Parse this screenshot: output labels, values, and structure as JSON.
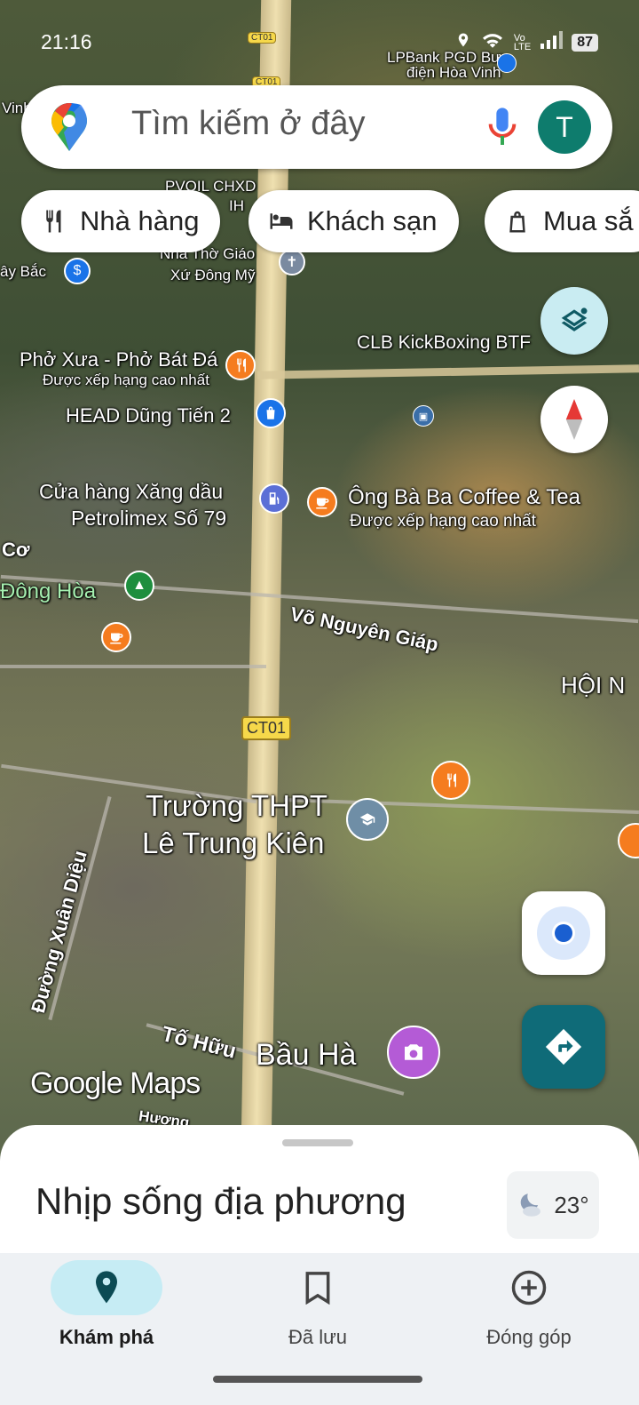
{
  "status_bar": {
    "time": "21:16",
    "battery": "87"
  },
  "search": {
    "placeholder": "Tìm kiếm ở đây",
    "avatar_letter": "T"
  },
  "chips": [
    {
      "label": "Nhà hàng",
      "icon": "restaurant-icon"
    },
    {
      "label": "Khách sạn",
      "icon": "hotel-icon"
    },
    {
      "label": "Mua sắ",
      "icon": "shopping-bag-icon"
    }
  ],
  "map": {
    "road_shields": [
      "CT01",
      "CT01",
      "CT01"
    ],
    "labels": {
      "lpbank": "LPBank PGD Bưu",
      "lpbank2": "điện Hòa Vinh",
      "vinh": "Vinh",
      "pvoil": "PVOIL CHXD",
      "pvoil2": "IH",
      "nhatho": "Nhà Thờ Giáo",
      "nhatho2": "Xứ Đông Mỹ",
      "taybac": "ây Bắc",
      "kickboxing": "CLB KickBoxing BTF",
      "phoxua": "Phở Xưa - Phở Bát Đá",
      "phoxua_sub": "Được xếp hạng cao nhất",
      "head": "HEAD Dũng Tiến 2",
      "xang": "Cửa hàng Xăng dầu",
      "xang2": "Petrolimex Số 79",
      "ongbaba": "Ông Bà Ba Coffee & Tea",
      "ongbaba_sub": "Được xếp hạng cao nhất",
      "co": "Cơ",
      "donghoa": "Đông Hòa",
      "vonguyengiap": "Võ Nguyên Giáp",
      "hoin": "HỘI N",
      "truong": "Trường THPT",
      "truong2": "Lê Trung Kiên",
      "xuandieu": "Đường Xuân Diệu",
      "tohuu": "Tố Hữu",
      "bauha": "Bầu Hà",
      "google": "Google Maps",
      "huong": "Hương"
    }
  },
  "bottom_sheet": {
    "title": "Nhịp sống địa phương",
    "temperature": "23°"
  },
  "nav": [
    {
      "label": "Khám phá",
      "icon": "explore-pin-icon",
      "active": true
    },
    {
      "label": "Đã lưu",
      "icon": "bookmark-icon",
      "active": false
    },
    {
      "label": "Đóng góp",
      "icon": "add-circle-icon",
      "active": false
    }
  ],
  "colors": {
    "accent": "#0f6b78",
    "avatar": "#0e7c6d",
    "nav_active": "#c6ecf4",
    "poi_orange": "#f57c1f",
    "poi_blue": "#1a73e8"
  }
}
